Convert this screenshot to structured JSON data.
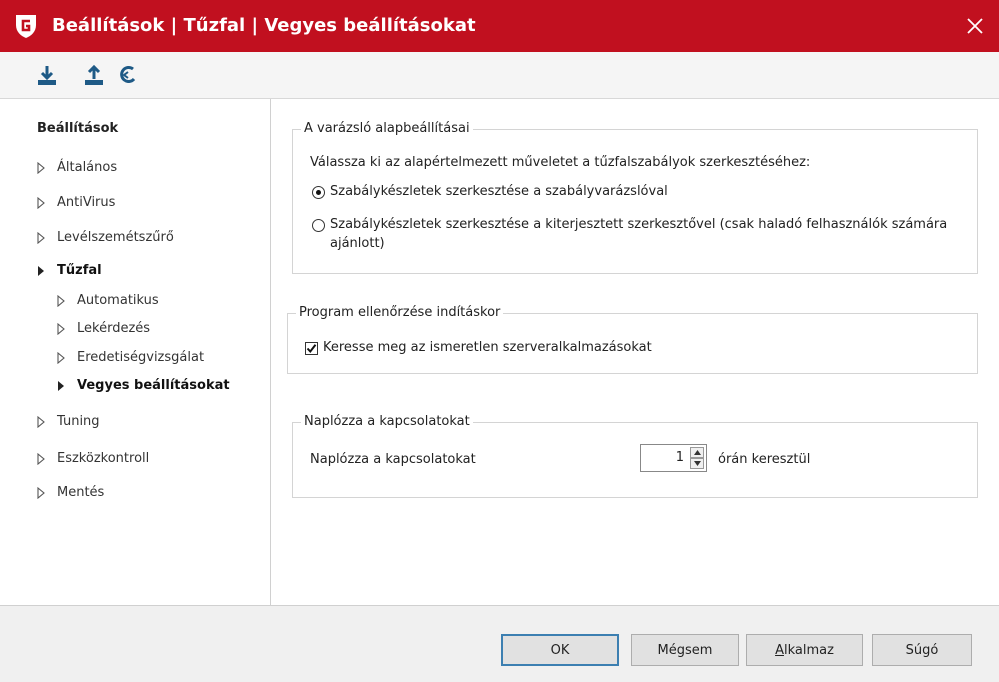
{
  "window": {
    "title": "Beállítások | Tűzfal | Vegyes beállításokat",
    "colors": {
      "title_bar": "#c1101f",
      "accent": "#3c7fb1"
    }
  },
  "toolbar": {
    "icons": [
      "download-icon",
      "upload-icon",
      "reset-icon"
    ]
  },
  "sidebar": {
    "heading": "Beállítások",
    "items": [
      {
        "label": "Általános"
      },
      {
        "label": "AntiVirus"
      },
      {
        "label": "Levélszemétszűrő"
      },
      {
        "label": "Tűzfal"
      },
      {
        "label": "Automatikus"
      },
      {
        "label": "Lekérdezés"
      },
      {
        "label": "Eredetiségvizsgálat"
      },
      {
        "label": "Vegyes beállításokat"
      },
      {
        "label": "Tuning"
      },
      {
        "label": "Eszközkontroll"
      },
      {
        "label": "Mentés"
      }
    ]
  },
  "wizard_group": {
    "legend": "A varázsló alapbeállításai",
    "prompt": "Válassza ki az alapértelmezett műveletet a tűzfalszabályok szerkesztéséhez:",
    "option1": "Szabálykészletek szerkesztése a szabályvarázslóval",
    "option2_line1": "Szabálykészletek szerkesztése a kiterjesztett szerkesztővel (csak haladó felhasználók számára",
    "option2_line2": "ajánlott)",
    "selected_option": 1
  },
  "startup_group": {
    "legend": "Program ellenőrzése indításkor",
    "checkbox_label": "Keresse meg az ismeretlen szerveralkalmazásokat",
    "checked": true
  },
  "log_group": {
    "legend": "Naplózza a kapcsolatokat",
    "label": "Naplózza a kapcsolatokat",
    "value": "1",
    "unit_suffix": "órán keresztül"
  },
  "buttons": {
    "ok": "OK",
    "cancel": "Mégsem",
    "apply_underlined": "A",
    "apply_rest": "lkalmaz",
    "help": "Súgó"
  }
}
